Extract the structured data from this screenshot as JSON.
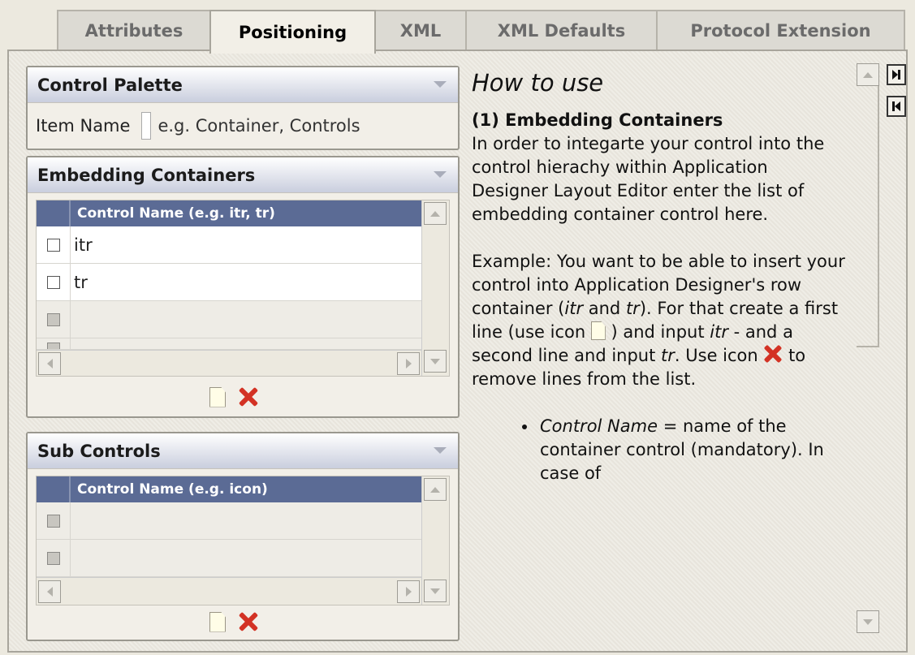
{
  "tabs": [
    {
      "label": "Attributes",
      "active": false
    },
    {
      "label": "Positioning",
      "active": true
    },
    {
      "label": "XML",
      "active": false
    },
    {
      "label": "XML Defaults",
      "active": false
    },
    {
      "label": "Protocol Extension",
      "active": false
    }
  ],
  "control_palette": {
    "title": "Control Palette",
    "item_name_label": "Item Name",
    "item_name_placeholder": "e.g. Container, Controls"
  },
  "embedding_containers": {
    "title": "Embedding Containers",
    "column_header": "Control Name (e.g. itr, tr)",
    "rows": [
      "itr",
      "tr"
    ]
  },
  "sub_controls": {
    "title": "Sub Controls",
    "column_header": "Control Name (e.g. icon)",
    "rows": []
  },
  "help": {
    "title": "How to use",
    "section_heading": "(1)  Embedding Containers",
    "para1": "In order to integarte your control into the control hierachy within Application Designer Layout Editor enter the list of embedding container control here.",
    "para2_a": "Example: You want to be able to insert your control into Application Designer's row container (",
    "para2_itr": "itr",
    "para2_and": " and ",
    "para2_tr": "tr",
    "para2_b": "). For that create a first line (use icon ",
    "para2_c": " ) and input ",
    "para2_itr2": "itr",
    "para2_d": " - and a second line and input ",
    "para2_tr2": "tr",
    "para2_e": ". Use icon ",
    "para2_f": " to remove lines from the list.",
    "bullet_italic": "Control Name",
    "bullet_text": " = name of the container control (mandatory). In case of"
  },
  "icons": {
    "new_line": "new-document-icon",
    "remove_line": "delete-x-icon",
    "nav_last": "last-page-icon",
    "nav_first": "first-page-icon"
  },
  "colors": {
    "grid_header": "#5b6b95",
    "remove_icon": "#d33224"
  }
}
